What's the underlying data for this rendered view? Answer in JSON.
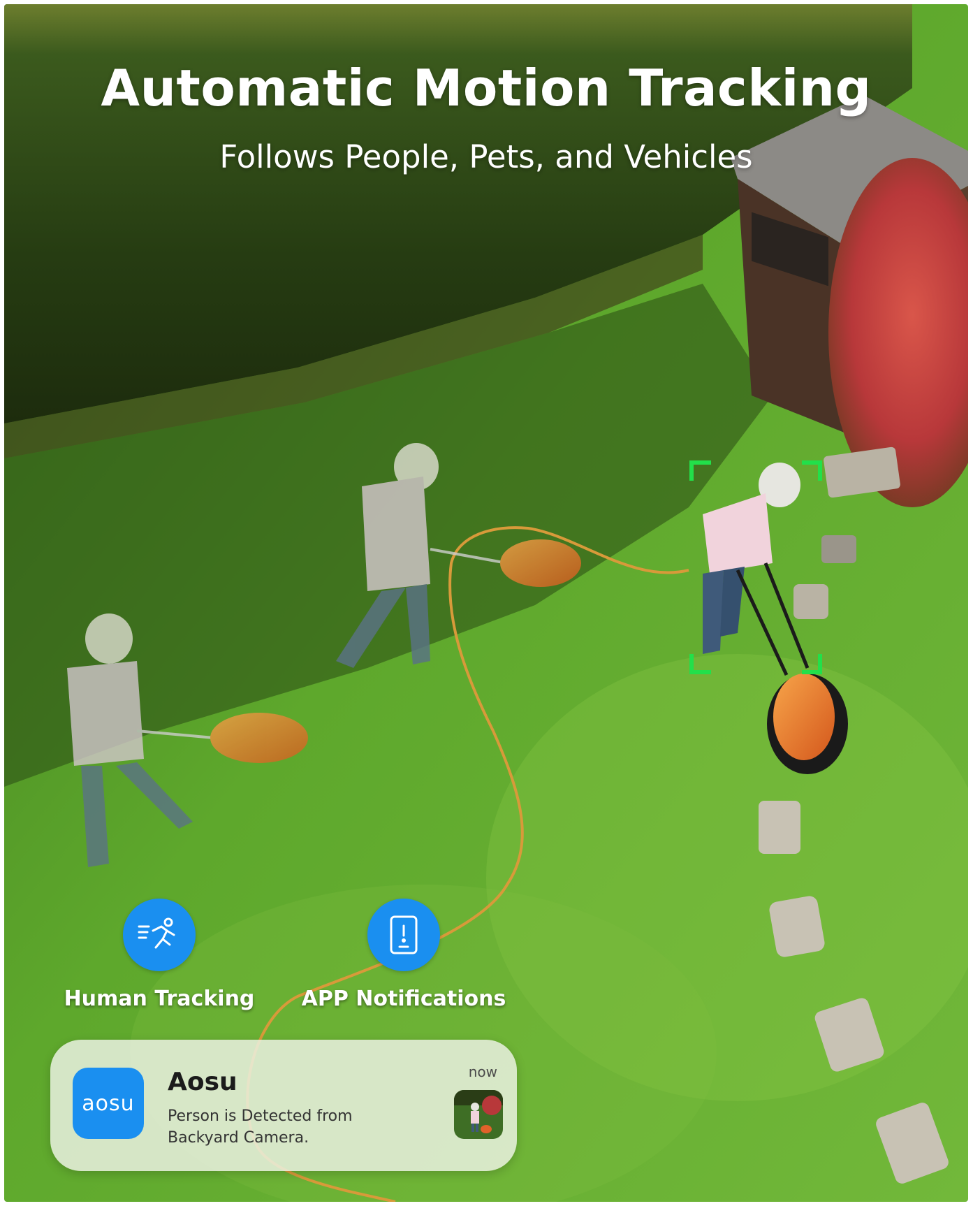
{
  "headline": {
    "title": "Automatic Motion Tracking",
    "subtitle": "Follows People, Pets, and Vehicles"
  },
  "features": [
    {
      "label": "Human Tracking",
      "icon": "running-person-icon"
    },
    {
      "label": "APP Notifications",
      "icon": "phone-alert-icon"
    }
  ],
  "notification": {
    "app_icon_text": "aosu",
    "app_name": "Aosu",
    "message": "Person is Detected from Backyard Camera.",
    "time": "now",
    "thumbnail_icon": "camera-snapshot-thumbnail"
  },
  "colors": {
    "accent": "#1a8ff0",
    "tracking_bracket": "#22e04a",
    "lawn": "#5aa82a",
    "hedge": "#2f4a18"
  }
}
